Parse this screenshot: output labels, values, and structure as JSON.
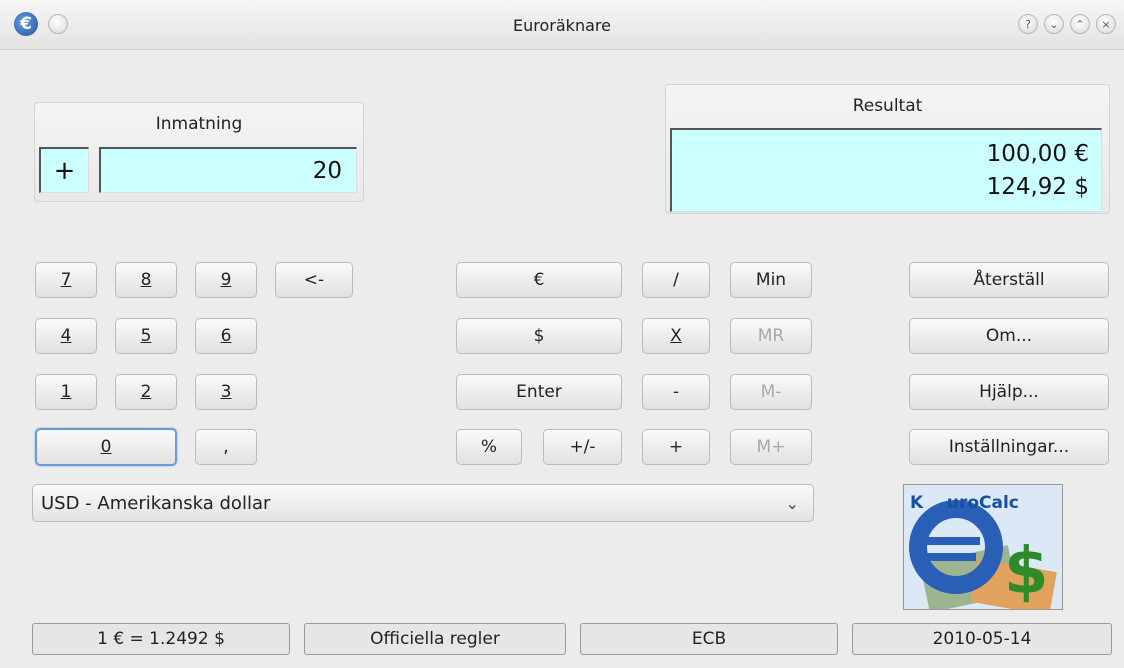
{
  "window": {
    "title": "Euroräknare",
    "app_icon_glyph": "€",
    "buttons": {
      "help": "?",
      "minimize": "⌄",
      "maximize": "⌃",
      "close": "×"
    }
  },
  "input": {
    "label": "Inmatning",
    "sign": "+",
    "value": "20"
  },
  "result": {
    "label": "Resultat",
    "line1": "100,00 €",
    "line2": "124,92 $"
  },
  "keypad": {
    "k7": "7",
    "k8": "8",
    "k9": "9",
    "back": "<-",
    "k4": "4",
    "k5": "5",
    "k6": "6",
    "k1": "1",
    "k2": "2",
    "k3": "3",
    "k0": "0",
    "comma": ","
  },
  "ops": {
    "euro": "€",
    "dollar": "$",
    "enter": "Enter",
    "percent": "%",
    "plusminus": "+/-",
    "divide": "/",
    "multiply": "X",
    "minus": "-",
    "plus": "+",
    "min": "Min",
    "mr": "MR",
    "mminus": "M-",
    "mplus": "M+"
  },
  "side": {
    "reset": "Återställ",
    "about": "Om...",
    "help": "Hjälp...",
    "settings": "Inställningar..."
  },
  "currency_select": {
    "selected": "USD - Amerikanska dollar"
  },
  "logo": {
    "text": "K    uroCalc"
  },
  "status": {
    "rate": "1 € = 1.2492 $",
    "rules": "Officiella regler",
    "source": "ECB",
    "date": "2010-05-14"
  },
  "colors": {
    "display_bg": "#ccffff",
    "window_bg": "#ececec",
    "focus": "#6b9bd6"
  }
}
